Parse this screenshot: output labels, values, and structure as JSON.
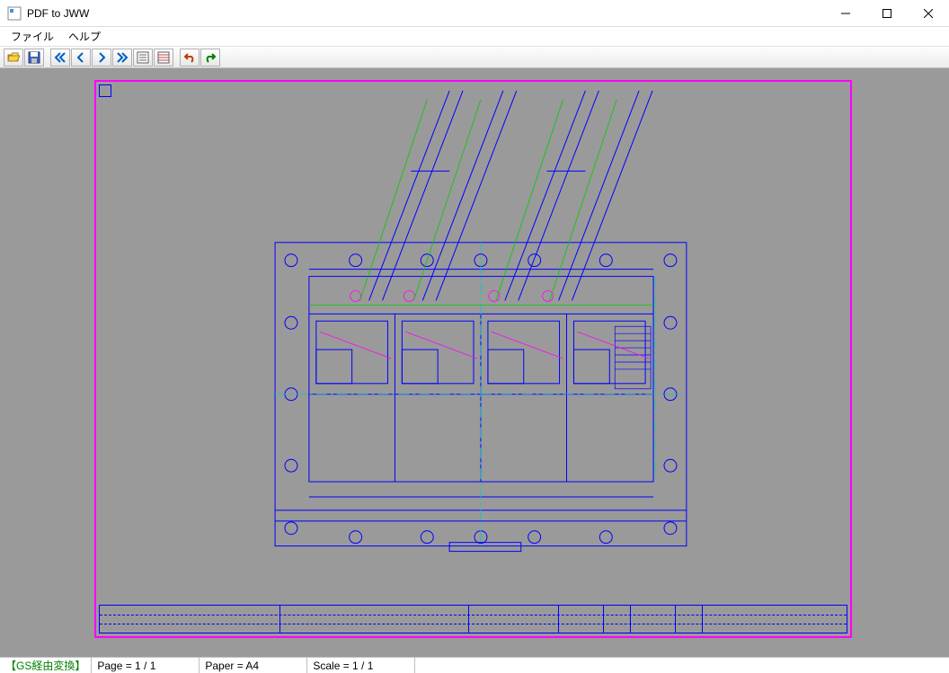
{
  "window": {
    "title": "PDF to JWW"
  },
  "menu": {
    "file": "ファイル",
    "help": "ヘルプ"
  },
  "toolbar": {
    "icons": [
      "open-icon",
      "save-icon",
      "first-icon",
      "prev-icon",
      "next-icon",
      "last-icon",
      "list-icon",
      "settings-icon",
      "undo-icon",
      "redo-icon"
    ]
  },
  "status": {
    "mode": "【GS経由変換】",
    "page": "Page = 1 / 1",
    "paper": "Paper = A4",
    "scale": "Scale = 1 / 1"
  },
  "colors": {
    "frame": "#ff00ff",
    "drawing": "#0000ff",
    "accent_green": "#00cc00",
    "accent_cyan": "#00cccc",
    "accent_magenta": "#ff00ff",
    "canvas_bg": "#9a9a9a"
  }
}
